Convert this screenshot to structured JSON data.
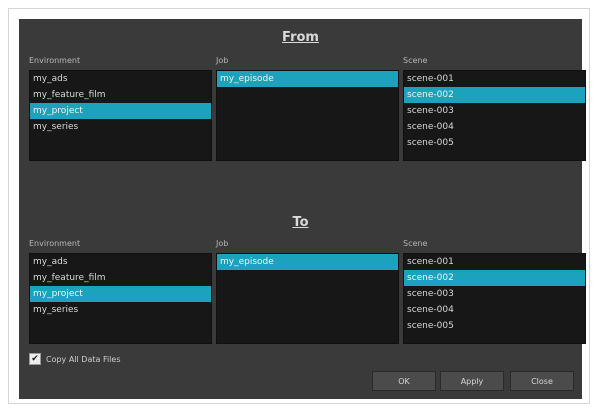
{
  "from": {
    "title": "From",
    "environment": {
      "label": "Environment",
      "items": [
        "my_ads",
        "my_feature_film",
        "my_project",
        "my_series"
      ],
      "selected": "my_project"
    },
    "job": {
      "label": "Job",
      "items": [
        "my_episode"
      ],
      "selected": "my_episode"
    },
    "scene": {
      "label": "Scene",
      "items": [
        "scene-001",
        "scene-002",
        "scene-003",
        "scene-004",
        "scene-005"
      ],
      "selected": "scene-002"
    }
  },
  "to": {
    "title": "To",
    "environment": {
      "label": "Environment",
      "items": [
        "my_ads",
        "my_feature_film",
        "my_project",
        "my_series"
      ],
      "selected": "my_project"
    },
    "job": {
      "label": "Job",
      "items": [
        "my_episode"
      ],
      "selected": "my_episode"
    },
    "scene": {
      "label": "Scene",
      "items": [
        "scene-001",
        "scene-002",
        "scene-003",
        "scene-004",
        "scene-005"
      ],
      "selected": "scene-002"
    }
  },
  "copy_all_data_files": {
    "label": "Copy All Data Files",
    "checked": true,
    "icon": "checkmark-icon"
  },
  "buttons": {
    "ok": "OK",
    "apply": "Apply",
    "close": "Close"
  },
  "colors": {
    "dialog_bg": "#3a3a3a",
    "list_bg": "#171717",
    "selection": "#1ba3bd"
  }
}
